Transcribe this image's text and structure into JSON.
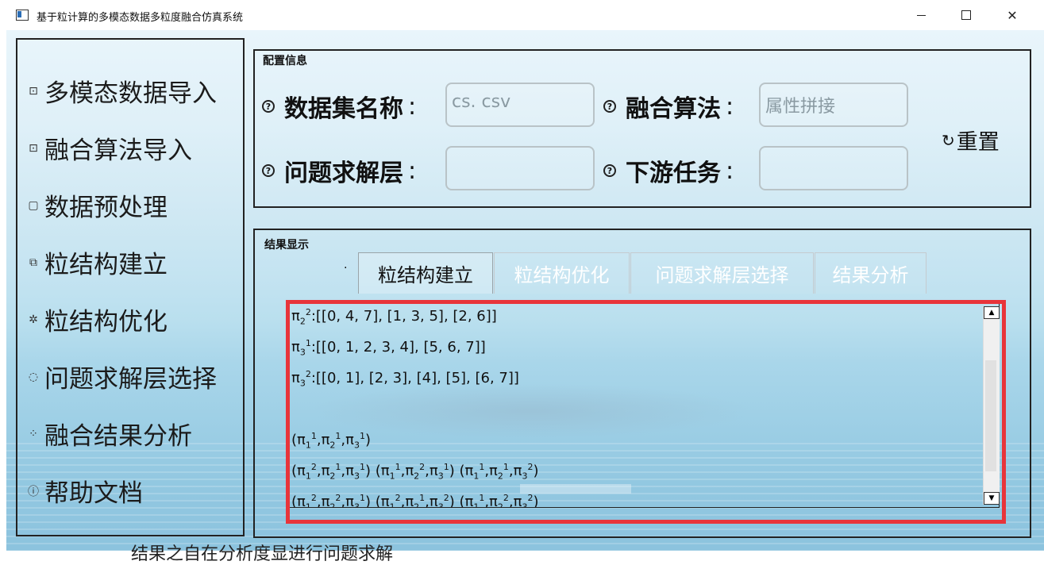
{
  "window": {
    "title": "基于粒计算的多模态数据多粒度融合仿真系统",
    "minimize": "minimize",
    "maximize": "maximize",
    "close": "✕"
  },
  "sidebar": {
    "items": [
      {
        "label": "多模态数据导入",
        "icon": "import-icon"
      },
      {
        "label": "融合算法导入",
        "icon": "algorithm-import-icon"
      },
      {
        "label": "数据预处理",
        "icon": "preprocess-icon"
      },
      {
        "label": "粒结构建立",
        "icon": "build-icon"
      },
      {
        "label": "粒结构优化",
        "icon": "optimize-icon"
      },
      {
        "label": "问题求解层选择",
        "icon": "bulb-icon"
      },
      {
        "label": "融合结果分析",
        "icon": "spinner-icon"
      },
      {
        "label": "帮助文档",
        "icon": "help-icon"
      }
    ]
  },
  "config": {
    "title": "配置信息",
    "dataset_label": "数据集名称",
    "dataset_value": "cs. csv",
    "algorithm_label": "融合算法",
    "algorithm_value": "属性拼接",
    "layer_label": "问题求解层",
    "layer_value": "",
    "task_label": "下游任务",
    "task_value": "",
    "colon": ":",
    "reset_label": "重置"
  },
  "result": {
    "title": "结果显示",
    "tabs": [
      "粒结构建立",
      "粒结构优化",
      "问题求解层选择",
      "结果分析"
    ],
    "active_tab": 0
  },
  "bottom_fragment": "结果之自在分析度显进行问题求解"
}
